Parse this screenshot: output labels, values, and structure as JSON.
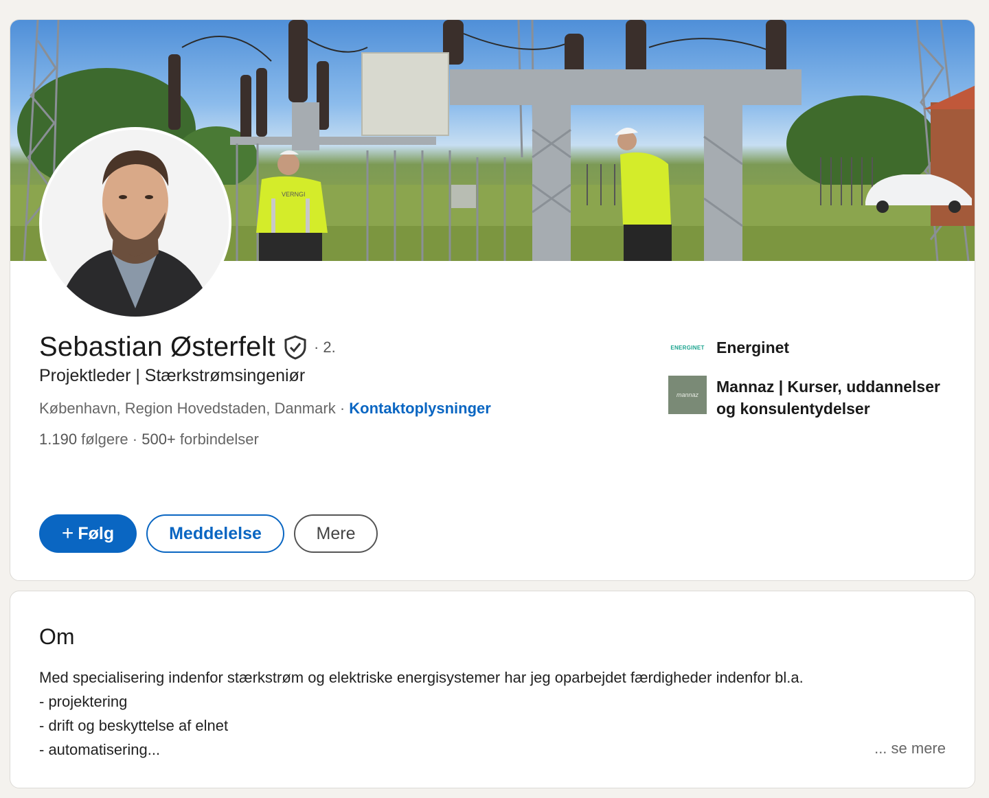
{
  "profile": {
    "name": "Sebastian Østerfelt",
    "degree": "· 2.",
    "headline": "Projektleder | Stærkstrømsingeniør",
    "location": "København, Region Hovedstaden, Danmark",
    "separator": " · ",
    "contact_link": "Kontaktoplysninger",
    "followers_count": "1.190",
    "followers_label": " følgere",
    "stats_separator": " · ",
    "connections_count": "500+",
    "connections_label": " forbindelser",
    "banner_vest_text": "VERNGI"
  },
  "companies": [
    {
      "name": "Energinet",
      "logo_text": "ENERGINET"
    },
    {
      "name_line1": "Mannaz | Kurser, uddannelser",
      "name_line2": "og konsulentydelser",
      "logo_text": "mannaz"
    }
  ],
  "actions": {
    "follow_icon": "+",
    "follow_label": "Følg",
    "message_label": "Meddelelse",
    "more_label": "Mere"
  },
  "about": {
    "title": "Om",
    "lines": [
      "Med specialisering indenfor stærkstrøm og elektriske energisystemer har jeg oparbejdet færdigheder indenfor bl.a.",
      "- projektering",
      "- drift og beskyttelse af elnet",
      "- automatisering..."
    ],
    "see_more": "... se mere"
  },
  "colors": {
    "accent": "#0a66c2",
    "background": "#f4f2ee",
    "card": "#ffffff"
  },
  "icons": {
    "verified": "shield-check-icon",
    "plus": "plus-icon"
  }
}
